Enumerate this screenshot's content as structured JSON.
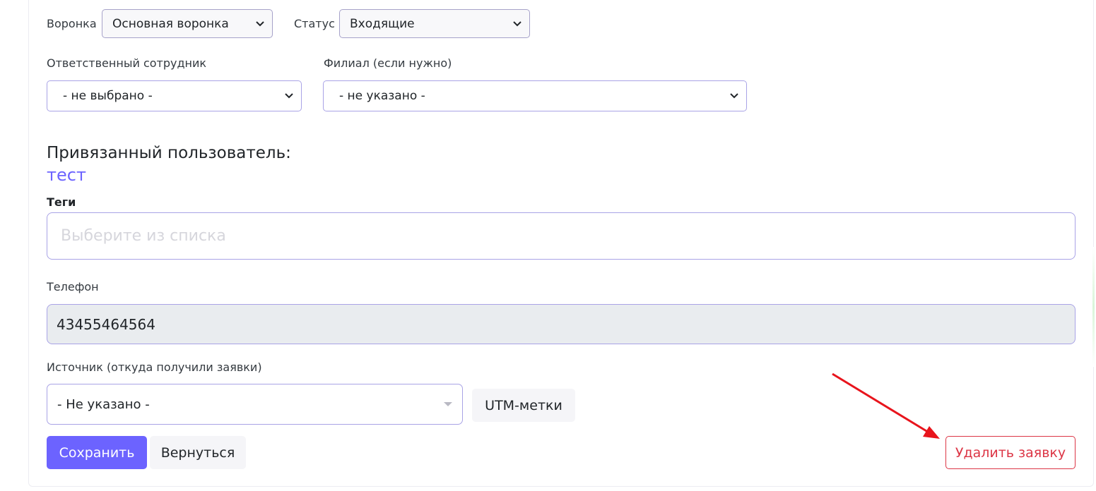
{
  "funnel": {
    "label": "Воронка",
    "selected": "Основная воронка"
  },
  "status": {
    "label": "Статус",
    "selected": "Входящие"
  },
  "responsible": {
    "label": "Ответственный сотрудник",
    "selected": "- не выбрано -"
  },
  "branch": {
    "label": "Филиал (если нужно)",
    "selected": "- не указано -"
  },
  "linked_user": {
    "heading": "Привязанный пользователь:",
    "name": "тест"
  },
  "tags": {
    "label": "Теги",
    "placeholder": "Выберите из списка"
  },
  "phone": {
    "label": "Телефон",
    "value": "43455464564"
  },
  "source": {
    "label": "Источник (откуда получили заявки)",
    "selected": "- Не указано -",
    "utm_button": "UTM-метки"
  },
  "actions": {
    "save": "Сохранить",
    "back": "Вернуться",
    "delete": "Удалить заявку"
  },
  "colors": {
    "primary": "#6c63ff",
    "danger": "#dc3545",
    "annotation_arrow": "#e8141c"
  }
}
